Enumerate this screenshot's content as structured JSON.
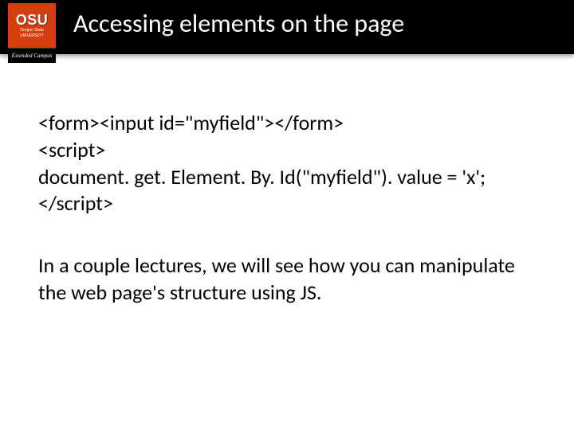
{
  "header": {
    "logo": {
      "acronym": "OSU",
      "line1": "Oregon State",
      "line2": "UNIVERSITY",
      "extended": "Extended Campus"
    },
    "title": "Accessing elements on the page"
  },
  "content": {
    "code": {
      "l1": "<form><input id=\"myfield\"></form>",
      "l2": "<script>",
      "l3": "document. get. Element. By. Id(\"myfield\"). value = 'x';",
      "l4": "</script>"
    },
    "note": "In a couple lectures, we will see how you can manipulate the web page's structure using JS."
  }
}
